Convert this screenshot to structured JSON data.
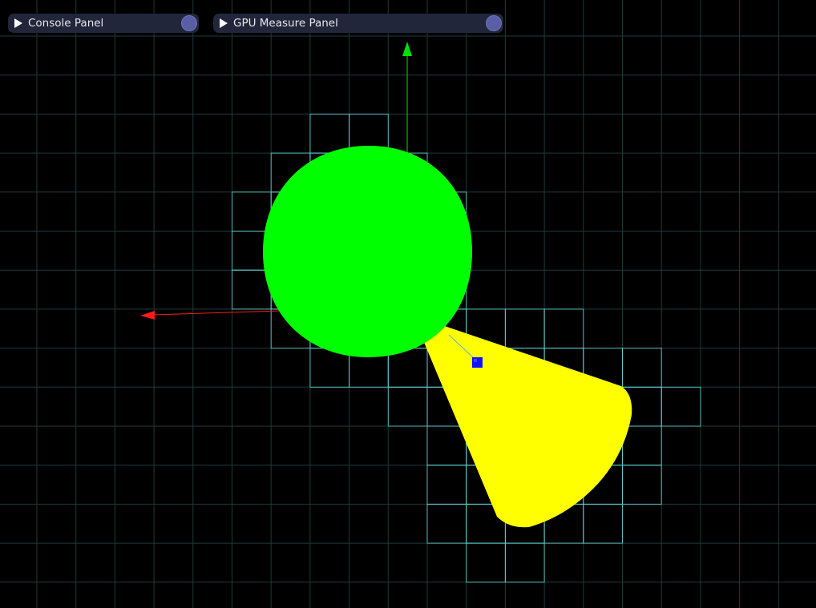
{
  "panels": {
    "console": {
      "label": "Console Panel"
    },
    "gpu_measure": {
      "label": "GPU Measure Panel"
    }
  },
  "colors": {
    "background": "#000000",
    "grid": "#1f3a3a",
    "cell_outline": "#5fd0d0",
    "sphere": "#00ff00",
    "cone": "#ffff00",
    "axis_x": "#ff1a1a",
    "axis_y": "#00e000",
    "marker": "#1010ff",
    "panel_bg": "#22263a",
    "panel_knob": "#5a5fa5"
  },
  "icons": {
    "expand": "triangle-right-icon",
    "toggle": "circle-knob-icon"
  }
}
